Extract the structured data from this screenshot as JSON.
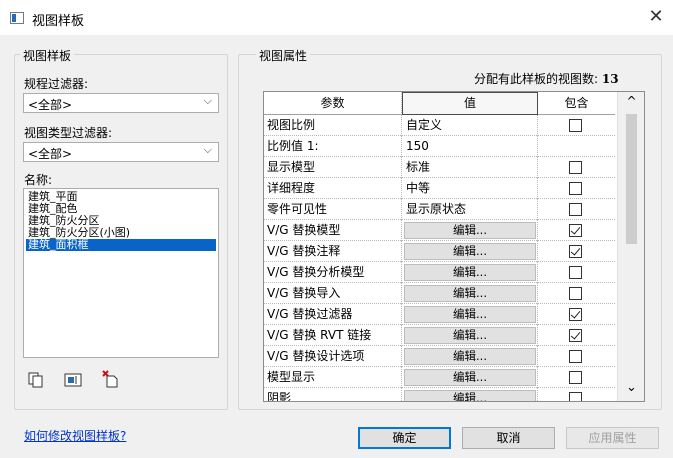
{
  "window": {
    "title": "视图样板",
    "close_glyph": "✕"
  },
  "left_panel": {
    "group_label": "视图样板",
    "discipline_filter": {
      "label": "规程过滤器:",
      "value": "<全部>"
    },
    "view_type_filter": {
      "label": "视图类型过滤器:",
      "value": "<全部>"
    },
    "names_label": "名称:",
    "names": [
      "建筑_平面",
      "建筑_配色",
      "建筑_防火分区",
      "建筑_防火分区(小图)",
      "建筑_面积框"
    ],
    "selected_index": 4,
    "icons": [
      "duplicate-icon",
      "rename-icon",
      "delete-icon"
    ]
  },
  "right_panel": {
    "group_label": "视图属性",
    "assigned_count_label": "分配有此样板的视图数:",
    "assigned_count": "13",
    "table": {
      "headers": {
        "param": "参数",
        "value": "值",
        "include": "包含"
      },
      "rows": [
        {
          "param": "视图比例",
          "value": "自定义",
          "type": "text",
          "include": false
        },
        {
          "param": "比例值 1:",
          "value": "150",
          "type": "text",
          "include": null
        },
        {
          "param": "显示模型",
          "value": "标准",
          "type": "text",
          "include": false
        },
        {
          "param": "详细程度",
          "value": "中等",
          "type": "text",
          "include": false
        },
        {
          "param": "零件可见性",
          "value": "显示原状态",
          "type": "text",
          "include": false
        },
        {
          "param": "V/G 替换模型",
          "value": "编辑...",
          "type": "button",
          "include": true
        },
        {
          "param": "V/G 替换注释",
          "value": "编辑...",
          "type": "button",
          "include": true
        },
        {
          "param": "V/G 替换分析模型",
          "value": "编辑...",
          "type": "button",
          "include": false
        },
        {
          "param": "V/G 替换导入",
          "value": "编辑...",
          "type": "button",
          "include": false
        },
        {
          "param": "V/G 替换过滤器",
          "value": "编辑...",
          "type": "button",
          "include": true
        },
        {
          "param": "V/G 替换 RVT 链接",
          "value": "编辑...",
          "type": "button",
          "include": true
        },
        {
          "param": "V/G 替换设计选项",
          "value": "编辑...",
          "type": "button",
          "include": false
        },
        {
          "param": "模型显示",
          "value": "编辑...",
          "type": "button",
          "include": false
        },
        {
          "param": "阴影",
          "value": "编辑...",
          "type": "button",
          "include": false
        }
      ]
    },
    "scroll_up": "^",
    "scroll_down": "⌄"
  },
  "footer": {
    "help_link": "如何修改视图样板?",
    "ok": "确定",
    "cancel": "取消",
    "apply": "应用属性"
  }
}
